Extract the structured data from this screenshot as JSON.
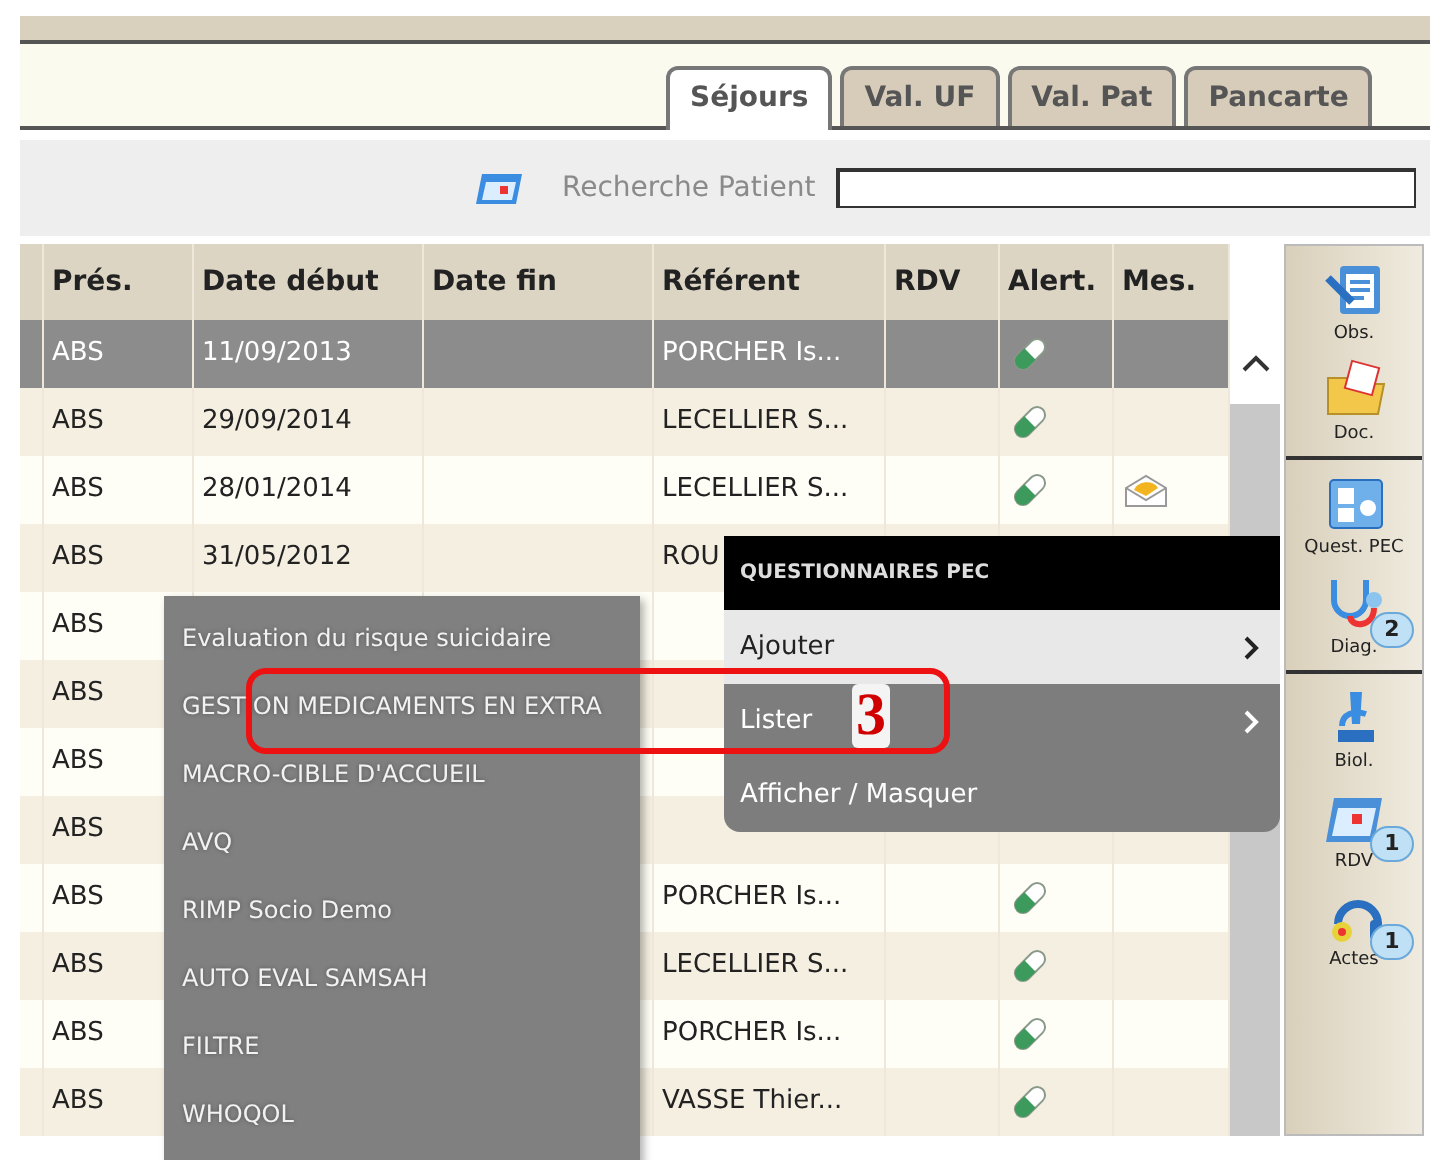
{
  "tabs": [
    {
      "label": "Séjours",
      "selected": true
    },
    {
      "label": "Val. UF",
      "selected": false
    },
    {
      "label": "Val. Pat",
      "selected": false
    },
    {
      "label": "Pancarte",
      "selected": false
    }
  ],
  "search": {
    "label": "Recherche Patient"
  },
  "table": {
    "columns": [
      "Prés.",
      "Date début",
      "Date fin",
      "Référent",
      "RDV",
      "Alert.",
      "Mes."
    ],
    "rows": [
      {
        "pres": "ABS",
        "date_debut": "11/09/2013",
        "referent": "PORCHER Is...",
        "alert": true,
        "message": false,
        "selected": true
      },
      {
        "pres": "ABS",
        "date_debut": "29/09/2014",
        "referent": "LECELLIER S...",
        "alert": true,
        "message": false,
        "selected": false
      },
      {
        "pres": "ABS",
        "date_debut": "28/01/2014",
        "referent": "LECELLIER S...",
        "alert": true,
        "message": true,
        "selected": false
      },
      {
        "pres": "ABS",
        "date_debut": "31/05/2012",
        "referent": "ROU",
        "alert": false,
        "message": false,
        "selected": false
      },
      {
        "pres": "ABS",
        "alert": false,
        "message": false,
        "selected": false
      },
      {
        "pres": "ABS",
        "alert": false,
        "message": false,
        "selected": false
      },
      {
        "pres": "ABS",
        "alert": false,
        "message": false,
        "selected": false
      },
      {
        "pres": "ABS",
        "alert": false,
        "message": false,
        "selected": false
      },
      {
        "pres": "ABS",
        "referent": "PORCHER Is...",
        "alert": true,
        "message": false,
        "selected": false
      },
      {
        "pres": "ABS",
        "referent": "LECELLIER S...",
        "alert": true,
        "message": false,
        "selected": false
      },
      {
        "pres": "ABS",
        "referent": "PORCHER Is...",
        "alert": true,
        "message": false,
        "selected": false
      },
      {
        "pres": "ABS",
        "referent": "VASSE Thier...",
        "alert": true,
        "message": false,
        "selected": false
      }
    ]
  },
  "context_menu": {
    "title": "QUESTIONNAIRES PEC",
    "items": [
      {
        "label": "Ajouter",
        "has_submenu": true,
        "selected": true
      },
      {
        "label": "Lister",
        "has_submenu": true,
        "selected": false
      },
      {
        "label": "Afficher / Masquer",
        "has_submenu": false,
        "selected": false
      }
    ]
  },
  "submenu": {
    "items": [
      "Evaluation du risque suicidaire",
      "GESTION MEDICAMENTS EN EXTRA",
      "MACRO-CIBLE D'ACCUEIL",
      "AVQ",
      "RIMP Socio Demo",
      "AUTO EVAL SAMSAH",
      "FILTRE",
      "WHOQOL"
    ]
  },
  "annotation": {
    "label": "3"
  },
  "sidebar": {
    "groups": [
      [
        {
          "label": "Obs.",
          "kind": "clipboard"
        },
        {
          "label": "Doc.",
          "kind": "folder"
        }
      ],
      [
        {
          "label": "Quest. PEC",
          "kind": "form"
        },
        {
          "label": "Diag.",
          "kind": "stethoscope",
          "badge": "2"
        }
      ],
      [
        {
          "label": "Biol.",
          "kind": "microscope"
        },
        {
          "label": "RDV",
          "kind": "calendar",
          "badge": "1"
        },
        {
          "label": "Actes",
          "kind": "headset",
          "badge": "1"
        }
      ]
    ]
  }
}
